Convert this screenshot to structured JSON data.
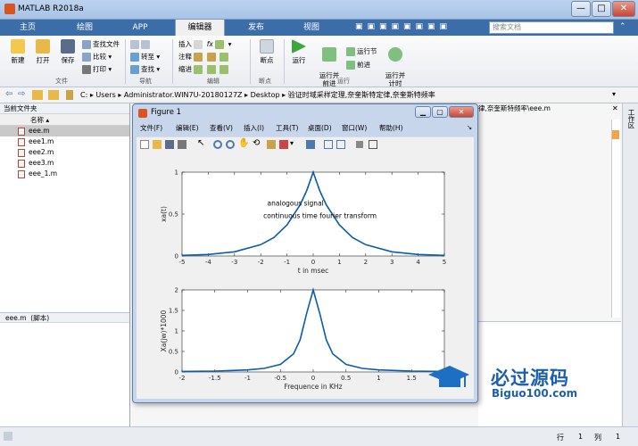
{
  "window": {
    "title": "MATLAB R2018a",
    "min_label": "—",
    "max_label": "□",
    "close_label": "✕"
  },
  "tabs": [
    "主页",
    "绘图",
    "APP",
    "编辑器",
    "发布",
    "视图"
  ],
  "search": {
    "placeholder": "搜索文档"
  },
  "ribbon": {
    "new": "新建",
    "open": "打开",
    "save": "保存",
    "find_files": "查找文件",
    "compare": "比较",
    "print": "打印",
    "insert": "插入",
    "comment": "注释",
    "indent": "缩进",
    "goto": "转至",
    "find": "查找",
    "breakpoints": "断点",
    "run": "运行",
    "run_advance": "运行并\n前进",
    "run_section": "运行节",
    "advance": "前进",
    "run_time": "运行并\n计时",
    "groups": {
      "file": "文件",
      "navigate": "导航",
      "edit": "编辑",
      "breakpoints": "断点",
      "run": "运行"
    },
    "fx": "fx"
  },
  "address": {
    "path": "C: ▸ Users ▸ Administrator.WIN7U-20180127Z ▸ Desktop ▸ 验证时域采样定理,奈奎斯特定律,奈奎斯特频率"
  },
  "editor_tab": "律,奈奎斯特频率\\eee.m",
  "left_panel": {
    "title": "当前文件夹",
    "column": "名称",
    "files": [
      "eee.m",
      "eee1.m",
      "eee2.m",
      "eee3.m",
      "eee_1.m"
    ],
    "details_title": "eee.m  (脚本)"
  },
  "figure": {
    "title": "Figure 1",
    "menu": [
      "文件(F)",
      "编辑(E)",
      "查看(V)",
      "插入(I)",
      "工具(T)",
      "桌面(D)",
      "窗口(W)",
      "帮助(H)"
    ]
  },
  "status": {
    "row_label": "行",
    "row": "1",
    "col_label": "列",
    "col": "1"
  },
  "watermark": {
    "cn": "必过源码",
    "en": "Biguo100.com"
  },
  "colors": {
    "line": "#0a5cad",
    "accent": "#3b6ea8"
  },
  "chart_data": [
    {
      "type": "line",
      "title": "",
      "xlabel": "t in msec",
      "ylabel": "xa(t)",
      "xlim": [
        -5,
        5
      ],
      "ylim": [
        0,
        1
      ],
      "xticks": [
        "-5",
        "-4",
        "-3",
        "-2",
        "-1",
        "0",
        "1",
        "2",
        "3",
        "4",
        "5"
      ],
      "yticks": [
        "0",
        "0.5",
        "1"
      ],
      "annotations": [
        "analogous signal",
        "continuous time fourier transform"
      ],
      "series": [
        {
          "x": [
            -5,
            -4,
            -3,
            -2,
            -1.5,
            -1,
            -0.5,
            -0.25,
            0,
            0.25,
            0.5,
            1,
            1.5,
            2,
            3,
            4,
            5
          ],
          "y": [
            0.007,
            0.018,
            0.05,
            0.135,
            0.22,
            0.37,
            0.61,
            0.78,
            1,
            0.78,
            0.61,
            0.37,
            0.22,
            0.135,
            0.05,
            0.018,
            0.007
          ]
        }
      ]
    },
    {
      "type": "line",
      "title": "",
      "xlabel": "Frequence in KHz",
      "ylabel": "Xa(jw)*1000",
      "xlim": [
        -2,
        2
      ],
      "ylim": [
        0,
        2
      ],
      "xticks": [
        "-2",
        "-1.5",
        "-1",
        "-0.5",
        "0",
        "0.5",
        "1",
        "1.5",
        "2"
      ],
      "yticks": [
        "0",
        "0.5",
        "1",
        "1.5",
        "2"
      ],
      "series": [
        {
          "x": [
            -2,
            -1.5,
            -1,
            -0.75,
            -0.5,
            -0.3,
            -0.2,
            -0.1,
            0,
            0.1,
            0.2,
            0.3,
            0.5,
            0.75,
            1,
            1.5,
            2
          ],
          "y": [
            0.012,
            0.022,
            0.05,
            0.086,
            0.184,
            0.44,
            0.78,
            1.43,
            2,
            1.43,
            0.78,
            0.44,
            0.184,
            0.086,
            0.05,
            0.022,
            0.012
          ]
        }
      ]
    }
  ]
}
